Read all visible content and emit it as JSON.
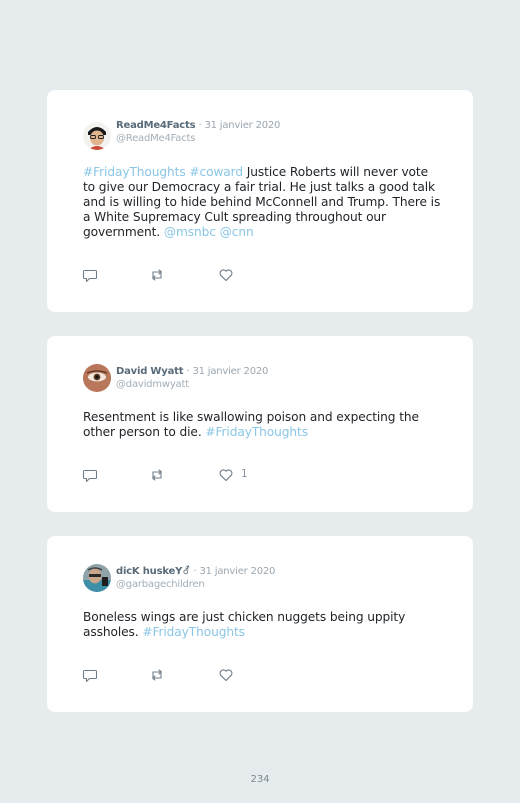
{
  "tweets": [
    {
      "name": "ReadMe4Facts",
      "date": "· 31 janvier 2020",
      "handle": "@ReadMe4Facts",
      "text_parts": [
        "#FridayThoughts",
        "#coward",
        "Justice Roberts will never vote to give our Democracy a fair trial. He just talks a good talk and is willing to hide behind McConnell and Trump. There is a White Supremacy Cult spreading throughout our government.",
        "@msnbc",
        "@cnn"
      ],
      "likes": ""
    },
    {
      "name": "David Wyatt",
      "date": "· 31 janvier 2020",
      "handle": "@davidmwyatt",
      "text_parts": [
        "Resentment is like swallowing poison and expecting the other person to die.",
        "#FridayThoughts"
      ],
      "likes": "1"
    },
    {
      "name": "dicK huskeY⚦",
      "date": "· 31 janvier 2020",
      "handle": "@garbagechildren",
      "text_parts": [
        "Boneless wings are just chicken nuggets being uppity assholes.",
        "#FridayThoughts"
      ],
      "likes": ""
    }
  ],
  "page_number": "234",
  "icons": [
    "reply-icon",
    "retweet-icon",
    "like-icon"
  ],
  "colors": {
    "background": "#e6ebee",
    "hashtag": "#8ac6e6",
    "name": "#596a78"
  }
}
